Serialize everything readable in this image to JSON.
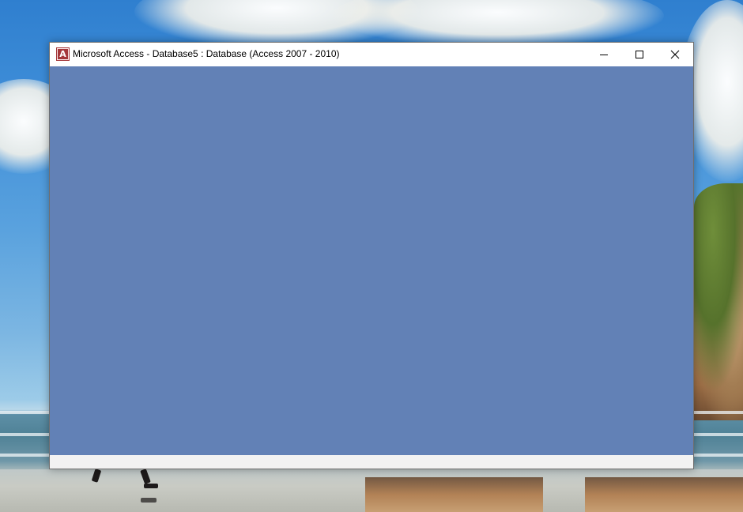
{
  "window": {
    "title": "Microsoft Access - Database5 : Database (Access 2007 - 2010)",
    "app_icon_letter": "A",
    "app_icon_name": "microsoft-access-icon",
    "controls": {
      "minimize": "minimize-icon",
      "maximize": "maximize-icon",
      "close": "close-icon"
    },
    "status_text": ""
  },
  "colors": {
    "client_background": "#6281b6",
    "titlebar_background": "#ffffff",
    "status_bar_background": "#f2f2f2",
    "access_brand": "#a4373a"
  }
}
